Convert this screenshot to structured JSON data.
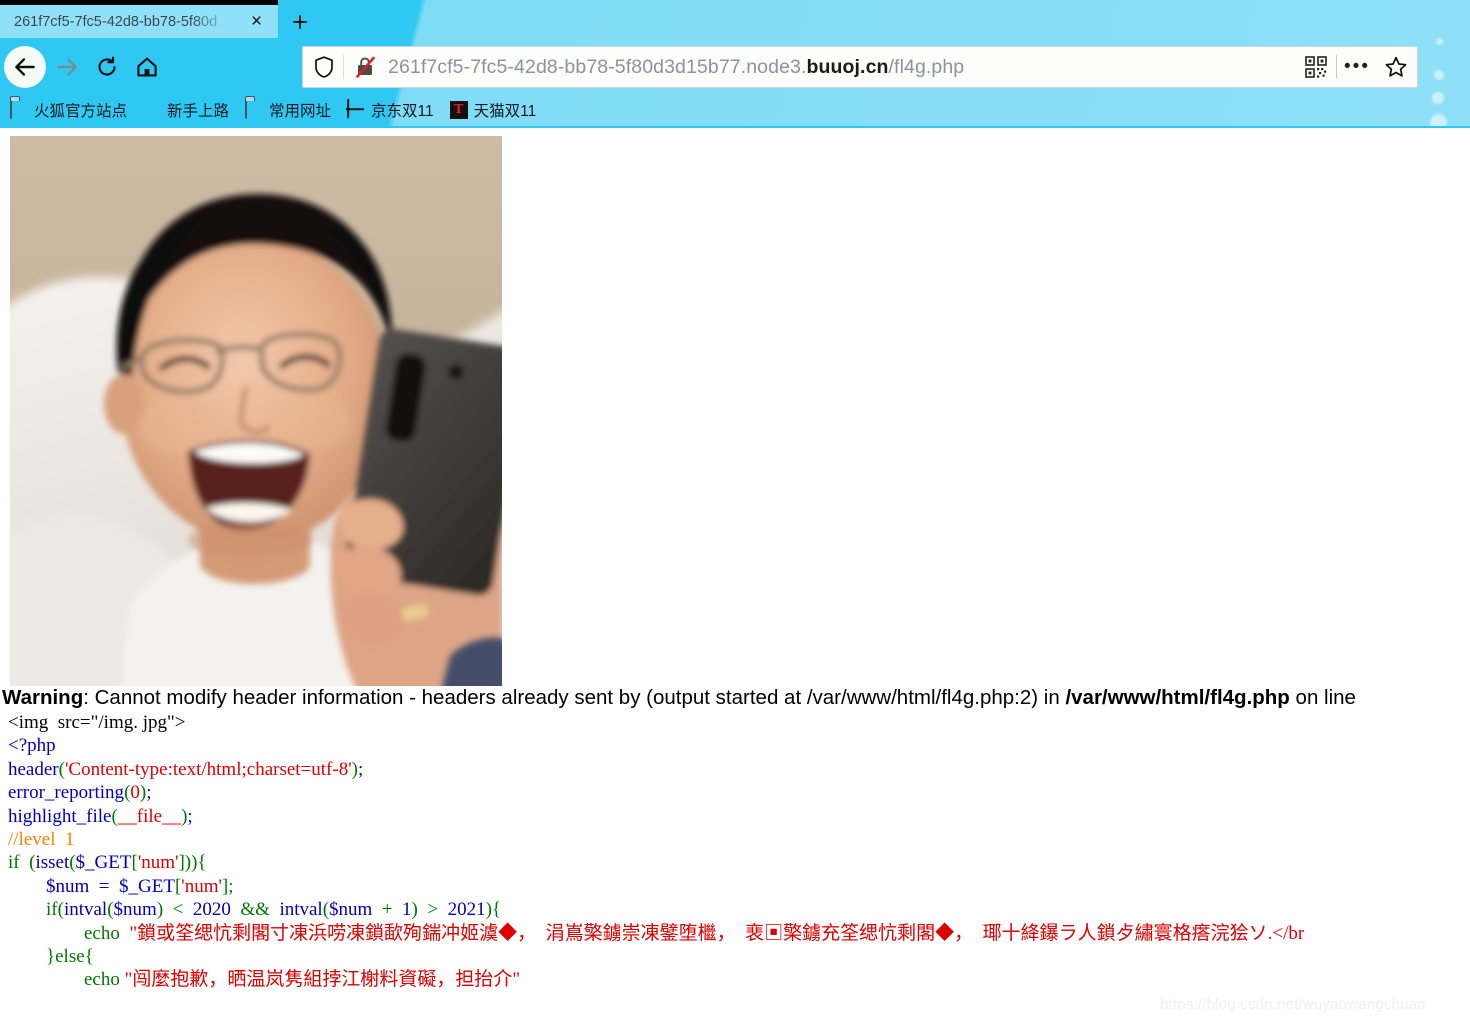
{
  "browser": {
    "tab": {
      "title": "261f7cf5-7fc5-42d8-bb78-5f80d",
      "close_label": "×",
      "newtab_label": "+"
    },
    "nav": {
      "back": "back-arrow",
      "forward": "forward-arrow",
      "reload": "reload",
      "home": "home"
    },
    "url": {
      "prefix": "261f7cf5-7fc5-42d8-bb78-5f80d3d15b77.node3.",
      "host": "buuoj.cn",
      "suffix": "/fl4g.php",
      "full": "261f7cf5-7fc5-42d8-bb78-5f80d3d15b77.node3.buuoj.cn/fl4g.php"
    },
    "url_actions": {
      "qr": "qr-code",
      "dots": "•••",
      "star": "☆"
    },
    "bookmarks": [
      {
        "label": "火狐官方站点",
        "icon": "folder"
      },
      {
        "label": "新手上路",
        "icon": "firefox"
      },
      {
        "label": "常用网址",
        "icon": "folder"
      },
      {
        "label": "京东双11",
        "icon": "globe"
      },
      {
        "label": "天猫双11",
        "icon": "tmall"
      }
    ]
  },
  "page": {
    "image_alt": "img.jpg",
    "warning": {
      "label": "Warning",
      "text_1": ": Cannot modify header information - headers already sent by (output started at /var/www/html/fl4g.php:2) in ",
      "file": "/var/www/html/fl4g.php",
      "text_2": " on line"
    },
    "code_lines": [
      {
        "segments": [
          {
            "t": "<img  src=\"/img. jpg\">",
            "c": "c-htm"
          }
        ]
      },
      {
        "segments": [
          {
            "t": "<?php",
            "c": "c-def"
          }
        ]
      },
      {
        "segments": [
          {
            "t": "header",
            "c": "c-def"
          },
          {
            "t": "(",
            "c": "c-kw"
          },
          {
            "t": "'Content-type:text/html;charset=utf-8'",
            "c": "c-str"
          },
          {
            "t": ")",
            "c": "c-kw"
          },
          {
            "t": ";",
            "c": "c-def"
          }
        ]
      },
      {
        "segments": [
          {
            "t": "error_reporting",
            "c": "c-def"
          },
          {
            "t": "(",
            "c": "c-kw"
          },
          {
            "t": "0",
            "c": "c-str"
          },
          {
            "t": ")",
            "c": "c-kw"
          },
          {
            "t": ";",
            "c": "c-def"
          }
        ]
      },
      {
        "segments": [
          {
            "t": "highlight_file",
            "c": "c-def"
          },
          {
            "t": "(",
            "c": "c-kw"
          },
          {
            "t": "__file__",
            "c": "c-str"
          },
          {
            "t": ")",
            "c": "c-kw"
          },
          {
            "t": ";",
            "c": "c-def"
          }
        ]
      },
      {
        "segments": [
          {
            "t": "",
            "c": "c-def"
          }
        ]
      },
      {
        "segments": [
          {
            "t": "",
            "c": "c-def"
          }
        ]
      },
      {
        "segments": [
          {
            "t": "//level  1",
            "c": "c-cmt"
          }
        ]
      },
      {
        "segments": [
          {
            "t": "if  (",
            "c": "c-kw"
          },
          {
            "t": "isset",
            "c": "c-def"
          },
          {
            "t": "(",
            "c": "c-kw"
          },
          {
            "t": "$_GET",
            "c": "c-def"
          },
          {
            "t": "[",
            "c": "c-kw"
          },
          {
            "t": "'num'",
            "c": "c-str"
          },
          {
            "t": "])){",
            "c": "c-kw"
          }
        ]
      },
      {
        "segments": [
          {
            "t": "        $num  =  $_GET",
            "c": "c-def"
          },
          {
            "t": "[",
            "c": "c-kw"
          },
          {
            "t": "'num'",
            "c": "c-str"
          },
          {
            "t": "];",
            "c": "c-kw"
          }
        ]
      },
      {
        "segments": [
          {
            "t": "        ",
            "c": "c-def"
          },
          {
            "t": "if",
            "c": "c-kw"
          },
          {
            "t": "(",
            "c": "c-kw"
          },
          {
            "t": "intval",
            "c": "c-def"
          },
          {
            "t": "(",
            "c": "c-kw"
          },
          {
            "t": "$num",
            "c": "c-def"
          },
          {
            "t": ")  <  ",
            "c": "c-kw"
          },
          {
            "t": "2020",
            "c": "c-def"
          },
          {
            "t": "  &&  ",
            "c": "c-kw"
          },
          {
            "t": "intval",
            "c": "c-def"
          },
          {
            "t": "(",
            "c": "c-kw"
          },
          {
            "t": "$num",
            "c": "c-def"
          },
          {
            "t": "  +  ",
            "c": "c-kw"
          },
          {
            "t": "1",
            "c": "c-def"
          },
          {
            "t": ")  >  ",
            "c": "c-kw"
          },
          {
            "t": "2021",
            "c": "c-def"
          },
          {
            "t": "){",
            "c": "c-kw"
          }
        ]
      },
      {
        "segments": [
          {
            "t": "                ",
            "c": "c-def"
          },
          {
            "t": "echo",
            "c": "c-kw"
          },
          {
            "t": "  \"鎖或筌缌忼剩閣寸凍浜唠凍鎖歃殉鍴冲姬澞◆，  涓嶌檠鐪崇凍鐾堕檵，  裵▣檠鐪充筌缌忼剩閣◆，  瑘十絳鑤ラ人鎖歺繡寰格瘩浣狯ソ.</br",
            "c": "c-str"
          }
        ]
      },
      {
        "segments": [
          {
            "t": "        }",
            "c": "c-kw"
          },
          {
            "t": "else",
            "c": "c-kw"
          },
          {
            "t": "{",
            "c": "c-kw"
          }
        ]
      },
      {
        "segments": [
          {
            "t": "                ",
            "c": "c-def"
          },
          {
            "t": "echo",
            "c": "c-kw"
          },
          {
            "t": " \"闯麼抱歉，晒温岚隽組挬江榭料資礙，担抬介\"",
            "c": "c-str"
          }
        ]
      }
    ],
    "watermark": "https://blog.csdn.net/wuyaowangchuan"
  },
  "colors": {
    "chrome_bg": "#7fdcf7",
    "chrome_accent": "#2fc8f2",
    "php_default": "#0000BB",
    "php_keyword": "#007700",
    "php_string": "#DD0000",
    "php_comment": "#FF8000"
  }
}
